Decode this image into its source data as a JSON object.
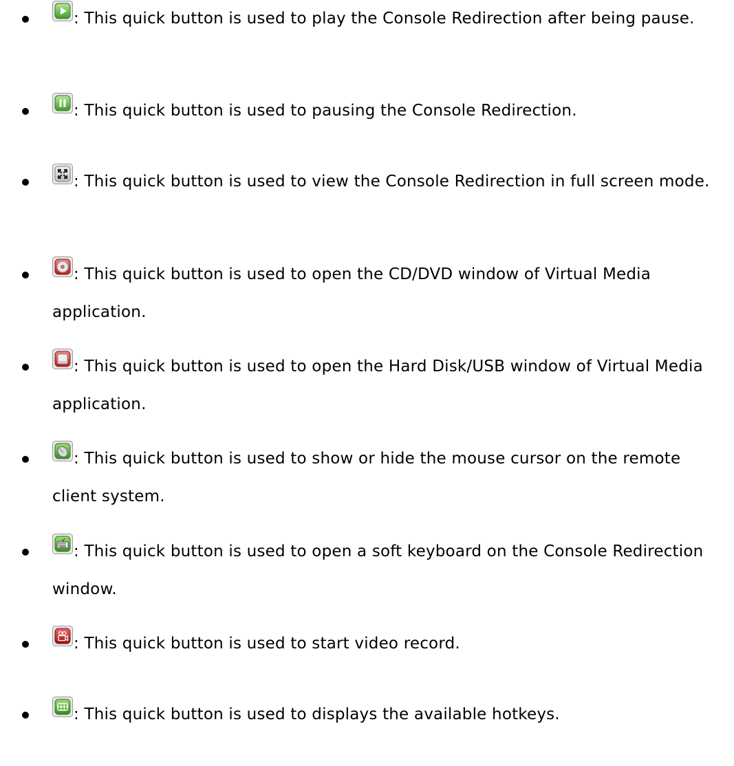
{
  "items": [
    {
      "icon": "play-icon",
      "separator": ":",
      "text": "This quick button is used to play the Console Redirection after being pause."
    },
    {
      "icon": "pause-icon",
      "separator": ":",
      "text": "This quick button is used to pausing the Console Redirection."
    },
    {
      "icon": "fullscreen-icon",
      "separator": ":",
      "text": "This quick button is used to view the Console Redirection in full screen mode."
    },
    {
      "icon": "cd-dvd-icon",
      "separator": ":",
      "text": "This quick button is used to open the CD/DVD window of Virtual Media application."
    },
    {
      "icon": "hard-disk-usb-icon",
      "separator": ":",
      "text": "This quick button is used to open the Hard Disk/USB window of Virtual Media application."
    },
    {
      "icon": "mouse-cursor-icon",
      "separator": ":",
      "text": "This quick button is used to show or hide the mouse cursor on the remote client system."
    },
    {
      "icon": "soft-keyboard-icon",
      "separator": ":",
      "text": "This quick button is used to open a soft keyboard on the Console Redirection window."
    },
    {
      "icon": "video-record-icon",
      "separator": ":",
      "text": "This quick button is used to start video record."
    },
    {
      "icon": "hotkeys-icon",
      "separator": ":",
      "text": "This quick button is used to displays the available hotkeys."
    }
  ]
}
